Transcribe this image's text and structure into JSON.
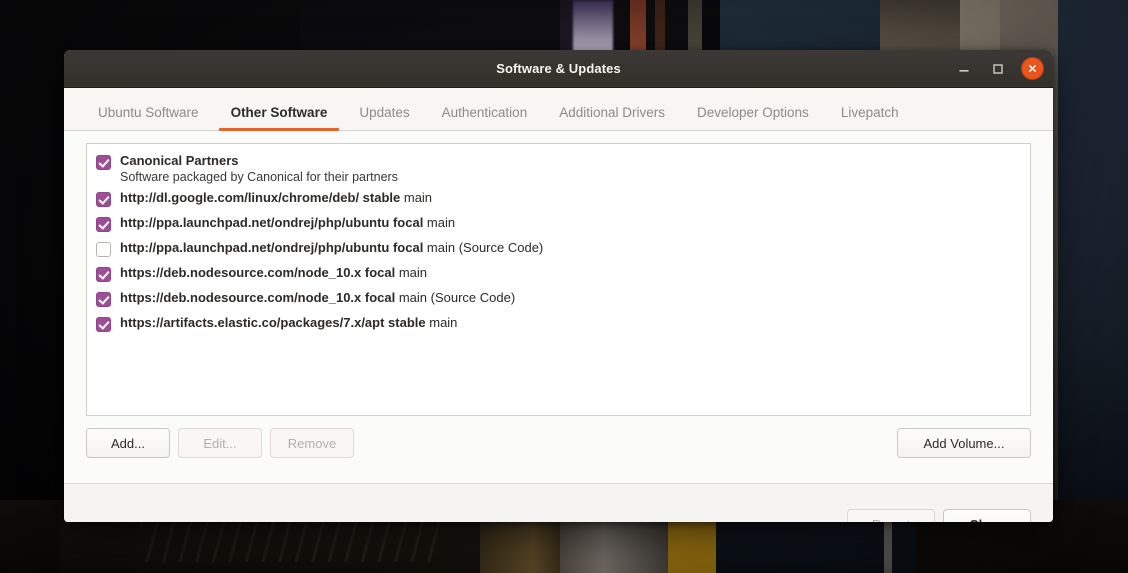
{
  "window": {
    "title": "Software & Updates",
    "controls": {
      "minimize": "minimize-icon",
      "maximize": "maximize-icon",
      "close": "close-icon"
    }
  },
  "tabs": [
    {
      "label": "Ubuntu Software",
      "active": false
    },
    {
      "label": "Other Software",
      "active": true
    },
    {
      "label": "Updates",
      "active": false
    },
    {
      "label": "Authentication",
      "active": false
    },
    {
      "label": "Additional Drivers",
      "active": false
    },
    {
      "label": "Developer Options",
      "active": false
    },
    {
      "label": "Livepatch",
      "active": false
    }
  ],
  "sources": [
    {
      "checked": true,
      "uri": "Canonical Partners",
      "suffix": "",
      "description": "Software packaged by Canonical for their partners"
    },
    {
      "checked": true,
      "uri": "http://dl.google.com/linux/chrome/deb/ stable",
      "suffix": " main",
      "description": ""
    },
    {
      "checked": true,
      "uri": "http://ppa.launchpad.net/ondrej/php/ubuntu focal",
      "suffix": " main",
      "description": ""
    },
    {
      "checked": false,
      "uri": "http://ppa.launchpad.net/ondrej/php/ubuntu focal",
      "suffix": " main (Source Code)",
      "description": ""
    },
    {
      "checked": true,
      "uri": "https://deb.nodesource.com/node_10.x focal",
      "suffix": " main",
      "description": ""
    },
    {
      "checked": true,
      "uri": "https://deb.nodesource.com/node_10.x focal",
      "suffix": " main (Source Code)",
      "description": ""
    },
    {
      "checked": true,
      "uri": "https://artifacts.elastic.co/packages/7.x/apt stable",
      "suffix": " main",
      "description": ""
    }
  ],
  "actions": {
    "add": "Add...",
    "edit": "Edit...",
    "remove": "Remove",
    "add_volume": "Add Volume..."
  },
  "footer": {
    "revert": "Revert",
    "close": "Close"
  },
  "colors": {
    "accent_orange": "#e4622e",
    "close_button": "#e9541f",
    "checkbox_purple": "#9c4f96",
    "titlebar": "#353330"
  }
}
